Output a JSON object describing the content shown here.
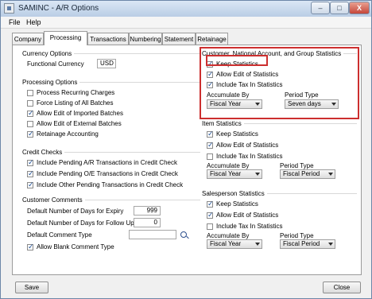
{
  "window": {
    "title": "SAMINC - A/R Options",
    "controls": [
      "–",
      "□",
      "X"
    ]
  },
  "menu": [
    "File",
    "Help"
  ],
  "tabs": [
    "Company",
    "Processing",
    "Transactions",
    "Numbering",
    "Statement",
    "Retainage"
  ],
  "left": {
    "currency": {
      "title": "Currency Options",
      "label": "Functional Currency",
      "value": "USD"
    },
    "processing": {
      "title": "Processing Options",
      "items": [
        {
          "label": "Process Recurring Charges",
          "checked": false
        },
        {
          "label": "Force Listing of All Batches",
          "checked": false
        },
        {
          "label": "Allow Edit of Imported Batches",
          "checked": true
        },
        {
          "label": "Allow Edit of External Batches",
          "checked": false
        },
        {
          "label": "Retainage Accounting",
          "checked": true
        }
      ]
    },
    "credit": {
      "title": "Credit Checks",
      "items": [
        {
          "label": "Include Pending A/R Transactions in Credit Check",
          "checked": true
        },
        {
          "label": "Include Pending O/E Transactions in Credit Check",
          "checked": true
        },
        {
          "label": "Include Other Pending Transactions in Credit Check",
          "checked": true
        }
      ]
    },
    "comments": {
      "title": "Customer Comments",
      "expiry_label": "Default Number of Days for Expiry",
      "expiry_value": "999",
      "followup_label": "Default Number of Days for Follow Up",
      "followup_value": "0",
      "comment_type_label": "Default Comment Type",
      "comment_type_value": "",
      "allow_blank_label": "Allow Blank Comment Type",
      "allow_blank_checked": true
    }
  },
  "right": {
    "customer": {
      "title": "Customer, National Account, and Group Statistics",
      "keep": "Keep Statistics",
      "allow_edit": "Allow Edit of Statistics",
      "include_tax": "Include Tax In Statistics",
      "accumulate_label": "Accumulate By",
      "accumulate_value": "Fiscal Year",
      "period_label": "Period Type",
      "period_value": "Seven days"
    },
    "item": {
      "title": "Item Statistics",
      "keep": "Keep Statistics",
      "allow_edit": "Allow Edit of Statistics",
      "include_tax": "Include Tax In Statistics",
      "accumulate_label": "Accumulate By",
      "accumulate_value": "Fiscal Year",
      "period_label": "Period Type",
      "period_value": "Fiscal Period"
    },
    "salesperson": {
      "title": "Salesperson Statistics",
      "keep": "Keep Statistics",
      "allow_edit": "Allow Edit of Statistics",
      "include_tax": "Include Tax In Statistics",
      "accumulate_label": "Accumulate By",
      "accumulate_value": "Fiscal Year",
      "period_label": "Period Type",
      "period_value": "Fiscal Period"
    }
  },
  "buttons": {
    "save": "Save",
    "close": "Close"
  }
}
